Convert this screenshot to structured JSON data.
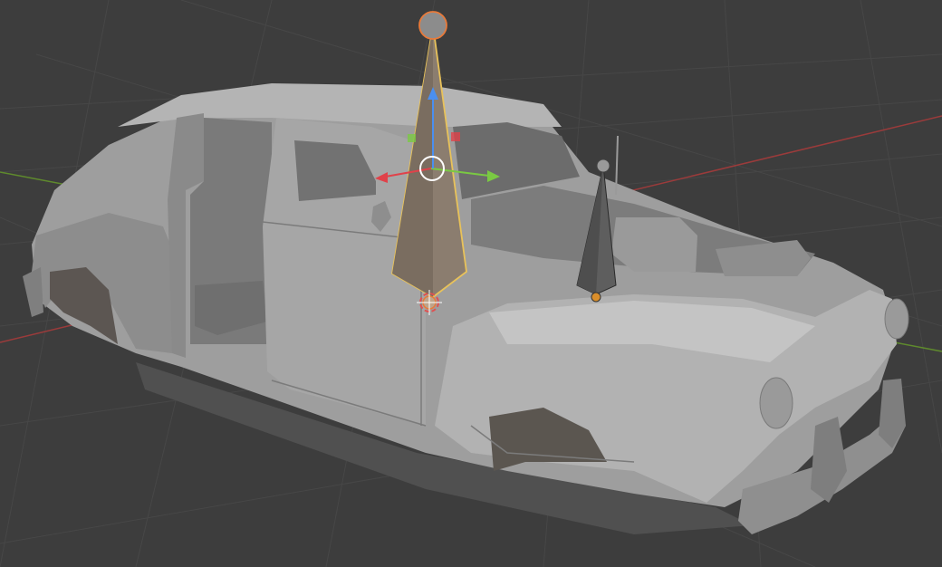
{
  "app": {
    "name": "3D Viewport"
  },
  "viewport": {
    "background": "#3d3d3d",
    "grid_color": "#4a4a4a",
    "x_axis_color": "#9b3b3b",
    "y_axis_color": "#5f8a2d",
    "mesh_base": "#9a9a9a",
    "mesh_light": "#b8b8b8",
    "mesh_dark": "#6f6f6f",
    "mesh_shadow": "#5a5550",
    "selection_outline": "#e8c25a",
    "active_bone_fill": "#8b7d6f",
    "bone_fill": "#5e5e5e",
    "gizmo": {
      "x_color": "#e0424a",
      "y_color": "#7ac943",
      "z_color": "#4a8ff0",
      "center_color": "#ffffff"
    }
  },
  "objects": [
    {
      "name": "car-body",
      "type": "mesh"
    },
    {
      "name": "bone-selected",
      "type": "bone",
      "selected": true
    },
    {
      "name": "bone-secondary",
      "type": "bone",
      "selected": false
    }
  ]
}
